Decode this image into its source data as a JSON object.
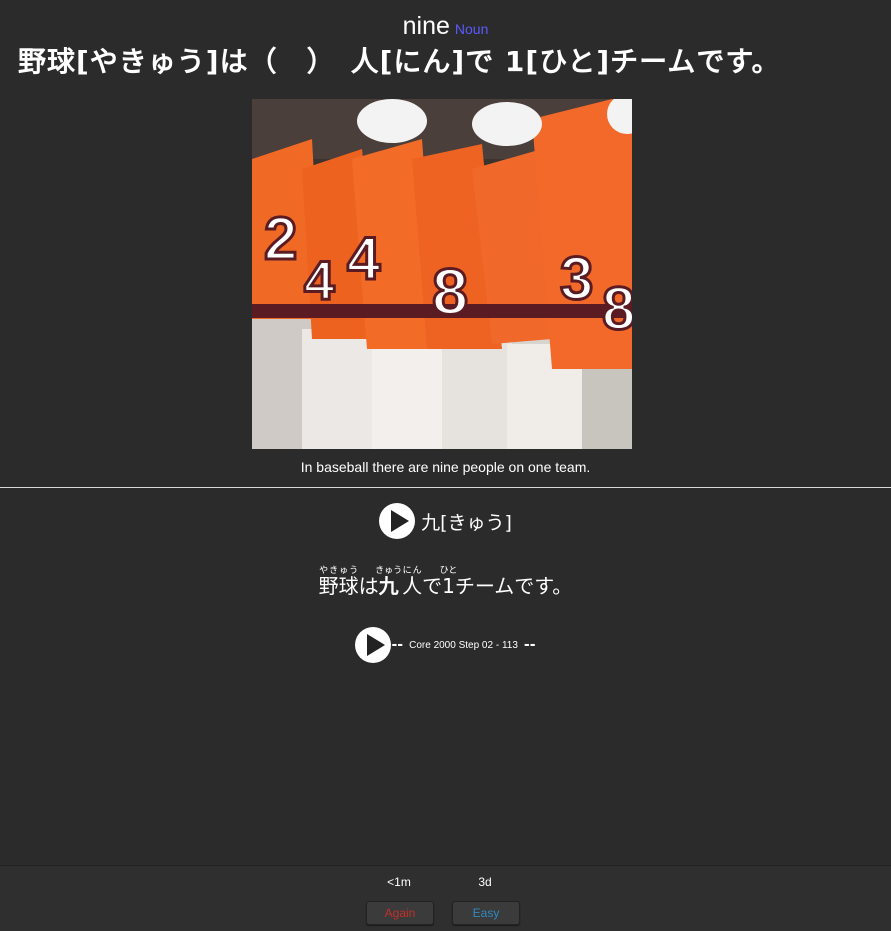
{
  "card": {
    "word": "nine",
    "part_of_speech": "Noun",
    "question": "野球[やきゅう]は（　）　人[にん]で 1[ひと]チームです。",
    "caption": "In baseball there are nine people on one team.",
    "answer": "九[きゅう]",
    "sentence": {
      "w1": "野球",
      "r1": "やきゅう",
      "w2": "は",
      "w3": "九",
      "r3": "きゅう",
      "w4": "人",
      "r4": "にん",
      "w5": "で",
      "w6": "1",
      "r6": "ひと",
      "w7": "チームです。"
    },
    "source": "Core 2000 Step 02 - 113",
    "dash": "--"
  },
  "footer": {
    "again_interval": "<1m",
    "easy_interval": "3d",
    "again_label": "Again",
    "easy_label": "Easy"
  },
  "colors": {
    "background": "#2b2b2b",
    "pos": "#5a5aff",
    "again": "#c0302a",
    "easy": "#2e8bc0"
  }
}
